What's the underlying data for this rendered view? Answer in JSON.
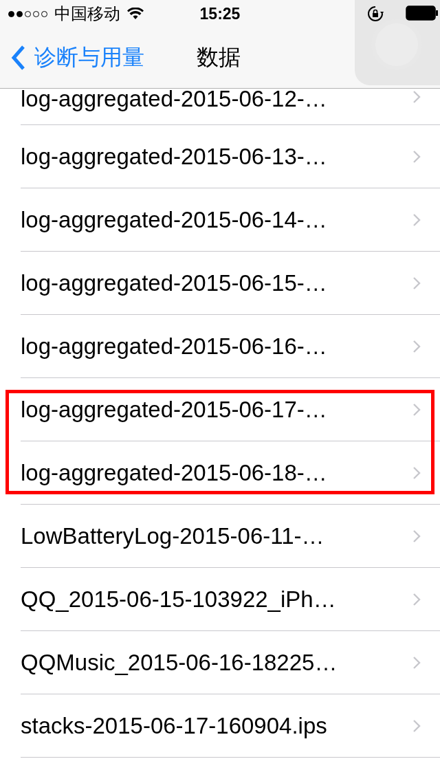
{
  "status_bar": {
    "carrier": "中国移动",
    "time": "15:25"
  },
  "nav": {
    "back": "诊断与用量",
    "title": "数据"
  },
  "rows": [
    {
      "label": "log-aggregated-2015-06-12-…",
      "highlighted": false
    },
    {
      "label": "log-aggregated-2015-06-13-…",
      "highlighted": false
    },
    {
      "label": "log-aggregated-2015-06-14-…",
      "highlighted": false
    },
    {
      "label": "log-aggregated-2015-06-15-…",
      "highlighted": false
    },
    {
      "label": "log-aggregated-2015-06-16-…",
      "highlighted": false
    },
    {
      "label": "log-aggregated-2015-06-17-…",
      "highlighted": true
    },
    {
      "label": "log-aggregated-2015-06-18-…",
      "highlighted": true
    },
    {
      "label": "LowBatteryLog-2015-06-11-…",
      "highlighted": false
    },
    {
      "label": "QQ_2015-06-15-103922_iPh…",
      "highlighted": false
    },
    {
      "label": "QQMusic_2015-06-16-18225…",
      "highlighted": false
    },
    {
      "label": "stacks-2015-06-17-160904.ips",
      "highlighted": false
    }
  ]
}
